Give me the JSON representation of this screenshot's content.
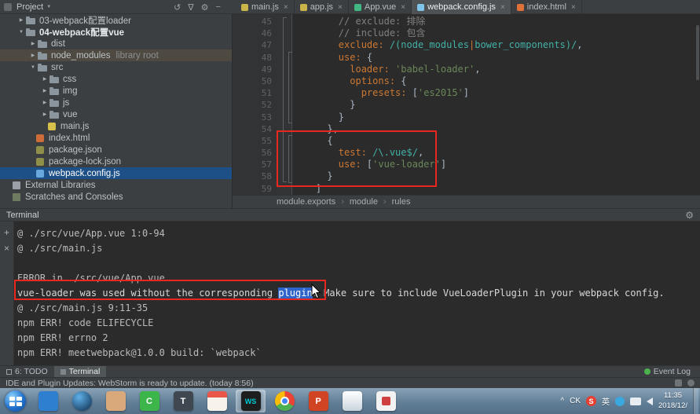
{
  "icons": {
    "close": "×",
    "arrow_down": "▼",
    "arrow_right": "▶",
    "menu_arrow": "▼",
    "gear": "⚙",
    "sync": "↺",
    "filter": "∇",
    "hide": "−",
    "plus": "+",
    "breadcrumb_sep": "›",
    "caret_up": "^"
  },
  "titlebar": {
    "project_label": "Project",
    "tabs": [
      {
        "label": "main.js",
        "icon": "js",
        "active": false
      },
      {
        "label": "app.js",
        "icon": "js",
        "active": false
      },
      {
        "label": "App.vue",
        "icon": "vue",
        "active": false
      },
      {
        "label": "webpack.config.js",
        "icon": "webpack",
        "active": true
      },
      {
        "label": "index.html",
        "icon": "html",
        "active": false
      }
    ]
  },
  "project_tree": {
    "items": [
      {
        "label": "03-webpack配置loader",
        "level": 1,
        "arrow": "right",
        "icon": "folder"
      },
      {
        "label": "04-webpack配置vue",
        "level": 1,
        "arrow": "down",
        "icon": "folder",
        "bold": true
      },
      {
        "label": "dist",
        "level": 2,
        "arrow": "right",
        "icon": "folder"
      },
      {
        "label": "node_modules",
        "level": 2,
        "arrow": "right",
        "icon": "folder",
        "suffix": "library root",
        "lib": true
      },
      {
        "label": "src",
        "level": 2,
        "arrow": "down",
        "icon": "folder"
      },
      {
        "label": "css",
        "level": 3,
        "arrow": "right",
        "icon": "folder"
      },
      {
        "label": "img",
        "level": 3,
        "arrow": "right",
        "icon": "folder"
      },
      {
        "label": "js",
        "level": 3,
        "arrow": "right",
        "icon": "folder"
      },
      {
        "label": "vue",
        "level": 3,
        "arrow": "right",
        "icon": "folder"
      },
      {
        "label": "main.js",
        "level": 3,
        "icon": "js"
      },
      {
        "label": "index.html",
        "level": 2,
        "icon": "html"
      },
      {
        "label": "package.json",
        "level": 2,
        "icon": "json"
      },
      {
        "label": "package-lock.json",
        "level": 2,
        "icon": "json"
      },
      {
        "label": "webpack.config.js",
        "level": 2,
        "icon": "webpack",
        "selected": true
      },
      {
        "label": "External Libraries",
        "level": 0,
        "icon": "extlib"
      },
      {
        "label": "Scratches and Consoles",
        "level": 0,
        "icon": "scratch"
      }
    ]
  },
  "editor": {
    "breadcrumbs": [
      "module.exports",
      "module",
      "rules"
    ],
    "lines": [
      {
        "num": 45,
        "seg": [
          {
            "t": "        // exclude: 排除",
            "y": "comment"
          }
        ]
      },
      {
        "num": 46,
        "seg": [
          {
            "t": "        // include: 包含",
            "y": "comment"
          }
        ]
      },
      {
        "num": 47,
        "seg": [
          {
            "t": "        ",
            "y": "plain"
          },
          {
            "t": "exclude: ",
            "y": "key"
          },
          {
            "t": "/(node_modules",
            "y": "regex"
          },
          {
            "t": "|",
            "y": "pipe"
          },
          {
            "t": "bower_components)/",
            "y": "regex"
          },
          {
            "t": ",",
            "y": "plain"
          }
        ]
      },
      {
        "num": 48,
        "seg": [
          {
            "t": "        ",
            "y": "plain"
          },
          {
            "t": "use: ",
            "y": "key"
          },
          {
            "t": "{",
            "y": "plain"
          }
        ]
      },
      {
        "num": 49,
        "seg": [
          {
            "t": "          ",
            "y": "plain"
          },
          {
            "t": "loader: ",
            "y": "key"
          },
          {
            "t": "'babel-loader'",
            "y": "string"
          },
          {
            "t": ",",
            "y": "plain"
          }
        ]
      },
      {
        "num": 50,
        "seg": [
          {
            "t": "          ",
            "y": "plain"
          },
          {
            "t": "options: ",
            "y": "key"
          },
          {
            "t": "{",
            "y": "plain"
          }
        ]
      },
      {
        "num": 51,
        "seg": [
          {
            "t": "            ",
            "y": "plain"
          },
          {
            "t": "presets: ",
            "y": "key"
          },
          {
            "t": "[",
            "y": "plain"
          },
          {
            "t": "'es2015'",
            "y": "string"
          },
          {
            "t": "]",
            "y": "plain"
          }
        ]
      },
      {
        "num": 52,
        "seg": [
          {
            "t": "          }",
            "y": "plain"
          }
        ]
      },
      {
        "num": 53,
        "seg": [
          {
            "t": "        }",
            "y": "plain"
          }
        ]
      },
      {
        "num": 54,
        "seg": [
          {
            "t": "      },",
            "y": "plain"
          }
        ]
      },
      {
        "num": 55,
        "seg": [
          {
            "t": "      {",
            "y": "plain"
          }
        ]
      },
      {
        "num": 56,
        "seg": [
          {
            "t": "        ",
            "y": "plain"
          },
          {
            "t": "test: ",
            "y": "key"
          },
          {
            "t": "/\\.vue$/",
            "y": "regex"
          },
          {
            "t": ",",
            "y": "plain"
          }
        ]
      },
      {
        "num": 57,
        "seg": [
          {
            "t": "        ",
            "y": "plain"
          },
          {
            "t": "use: ",
            "y": "key"
          },
          {
            "t": "[",
            "y": "plain"
          },
          {
            "t": "'vue-loader'",
            "y": "string"
          },
          {
            "t": "]",
            "y": "plain"
          }
        ]
      },
      {
        "num": 58,
        "seg": [
          {
            "t": "      }",
            "y": "plain"
          }
        ]
      },
      {
        "num": 59,
        "seg": [
          {
            "t": "    ]",
            "y": "plain"
          }
        ]
      }
    ]
  },
  "terminal": {
    "title": "Terminal",
    "lines": [
      [
        {
          "t": "@ ./src/vue/App.vue 1:0-94",
          "y": "plain"
        }
      ],
      [
        {
          "t": "@ ./src/main.js",
          "y": "plain"
        }
      ],
      [],
      [
        {
          "t": "ERROR in ./src/vue/App.vue",
          "y": "plain"
        }
      ],
      [
        {
          "t": "vue-loader was used without the corresponding ",
          "y": "bright"
        },
        {
          "t": "plugin",
          "y": "sel"
        },
        {
          "t": ". Make sure to include VueLoaderPlugin in your webpack config.",
          "y": "bright"
        }
      ],
      [
        {
          "t": "@ ./src/main.js 9:11-35",
          "y": "plain"
        }
      ],
      [
        {
          "t": "npm ERR! code ELIFECYCLE",
          "y": "plain"
        }
      ],
      [
        {
          "t": "npm ERR! errno 2",
          "y": "plain"
        }
      ],
      [
        {
          "t": "npm ERR! meetwebpack@1.0.0 build: `webpack`",
          "y": "plain"
        }
      ]
    ]
  },
  "bottombar": {
    "todo": "6: TODO",
    "terminal": "Terminal",
    "event_log": "Event Log"
  },
  "statusbar": {
    "message": "IDE and Plugin Updates: WebStorm is ready to update. (today 8:56)"
  },
  "taskbar": {
    "icons": [
      {
        "name": "app-blue-window",
        "bg": "#2f7fd0"
      },
      {
        "name": "app-dark-sphere",
        "cls": "ic-circle",
        "bg": "radial-gradient(circle at 35% 30%, #5fb0e8, #0c2a4a)"
      },
      {
        "name": "app-avatar",
        "bg": "#d9a97c"
      },
      {
        "name": "app-green",
        "bg": "#3cb54a",
        "glyph": "C",
        "fg": "#ffffff"
      },
      {
        "name": "app-t",
        "bg": "#3f4750",
        "glyph": "T",
        "fg": "#ffffff"
      },
      {
        "name": "app-calendar",
        "cls": "ic-cal"
      },
      {
        "name": "webstorm",
        "cls": "ic-ws",
        "bg": "#1d1d1d",
        "glyph": "WS",
        "fg": "#00cdd7",
        "active": true
      },
      {
        "name": "chrome",
        "cls": "ic-chrome",
        "chrome": true
      },
      {
        "name": "powerpoint",
        "bg": "#d04423",
        "glyph": "P",
        "fg": "#ffffff"
      },
      {
        "name": "app-light",
        "bg": "linear-gradient(#ffffff,#c9d4dc)"
      },
      {
        "name": "app-red-white",
        "cls": "ic-redmark",
        "bg": "#f2f2f2"
      }
    ],
    "tray": {
      "ck": "CK",
      "sogou_letter": "S",
      "ime": "英",
      "time": "11:35",
      "date": "2018/12/"
    }
  }
}
